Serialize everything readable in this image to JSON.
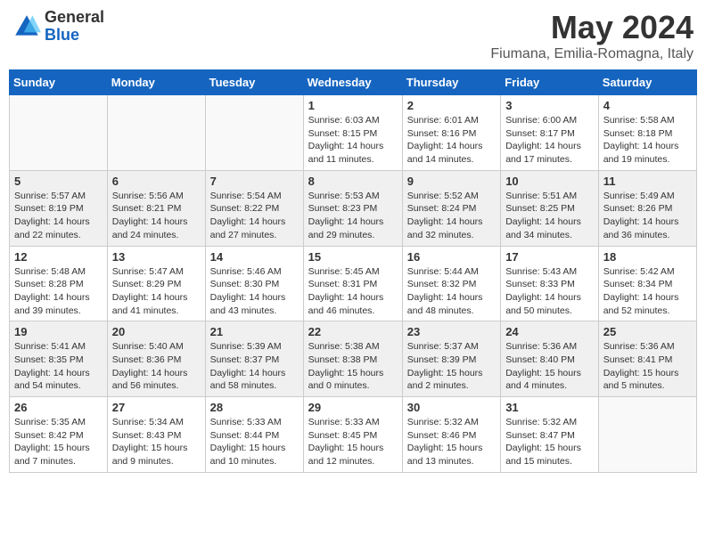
{
  "header": {
    "logo": {
      "general": "General",
      "blue": "Blue"
    },
    "month": "May 2024",
    "location": "Fiumana, Emilia-Romagna, Italy"
  },
  "weekdays": [
    "Sunday",
    "Monday",
    "Tuesday",
    "Wednesday",
    "Thursday",
    "Friday",
    "Saturday"
  ],
  "weeks": [
    [
      {
        "day": "",
        "info": ""
      },
      {
        "day": "",
        "info": ""
      },
      {
        "day": "",
        "info": ""
      },
      {
        "day": "1",
        "info": "Sunrise: 6:03 AM\nSunset: 8:15 PM\nDaylight: 14 hours\nand 11 minutes."
      },
      {
        "day": "2",
        "info": "Sunrise: 6:01 AM\nSunset: 8:16 PM\nDaylight: 14 hours\nand 14 minutes."
      },
      {
        "day": "3",
        "info": "Sunrise: 6:00 AM\nSunset: 8:17 PM\nDaylight: 14 hours\nand 17 minutes."
      },
      {
        "day": "4",
        "info": "Sunrise: 5:58 AM\nSunset: 8:18 PM\nDaylight: 14 hours\nand 19 minutes."
      }
    ],
    [
      {
        "day": "5",
        "info": "Sunrise: 5:57 AM\nSunset: 8:19 PM\nDaylight: 14 hours\nand 22 minutes."
      },
      {
        "day": "6",
        "info": "Sunrise: 5:56 AM\nSunset: 8:21 PM\nDaylight: 14 hours\nand 24 minutes."
      },
      {
        "day": "7",
        "info": "Sunrise: 5:54 AM\nSunset: 8:22 PM\nDaylight: 14 hours\nand 27 minutes."
      },
      {
        "day": "8",
        "info": "Sunrise: 5:53 AM\nSunset: 8:23 PM\nDaylight: 14 hours\nand 29 minutes."
      },
      {
        "day": "9",
        "info": "Sunrise: 5:52 AM\nSunset: 8:24 PM\nDaylight: 14 hours\nand 32 minutes."
      },
      {
        "day": "10",
        "info": "Sunrise: 5:51 AM\nSunset: 8:25 PM\nDaylight: 14 hours\nand 34 minutes."
      },
      {
        "day": "11",
        "info": "Sunrise: 5:49 AM\nSunset: 8:26 PM\nDaylight: 14 hours\nand 36 minutes."
      }
    ],
    [
      {
        "day": "12",
        "info": "Sunrise: 5:48 AM\nSunset: 8:28 PM\nDaylight: 14 hours\nand 39 minutes."
      },
      {
        "day": "13",
        "info": "Sunrise: 5:47 AM\nSunset: 8:29 PM\nDaylight: 14 hours\nand 41 minutes."
      },
      {
        "day": "14",
        "info": "Sunrise: 5:46 AM\nSunset: 8:30 PM\nDaylight: 14 hours\nand 43 minutes."
      },
      {
        "day": "15",
        "info": "Sunrise: 5:45 AM\nSunset: 8:31 PM\nDaylight: 14 hours\nand 46 minutes."
      },
      {
        "day": "16",
        "info": "Sunrise: 5:44 AM\nSunset: 8:32 PM\nDaylight: 14 hours\nand 48 minutes."
      },
      {
        "day": "17",
        "info": "Sunrise: 5:43 AM\nSunset: 8:33 PM\nDaylight: 14 hours\nand 50 minutes."
      },
      {
        "day": "18",
        "info": "Sunrise: 5:42 AM\nSunset: 8:34 PM\nDaylight: 14 hours\nand 52 minutes."
      }
    ],
    [
      {
        "day": "19",
        "info": "Sunrise: 5:41 AM\nSunset: 8:35 PM\nDaylight: 14 hours\nand 54 minutes."
      },
      {
        "day": "20",
        "info": "Sunrise: 5:40 AM\nSunset: 8:36 PM\nDaylight: 14 hours\nand 56 minutes."
      },
      {
        "day": "21",
        "info": "Sunrise: 5:39 AM\nSunset: 8:37 PM\nDaylight: 14 hours\nand 58 minutes."
      },
      {
        "day": "22",
        "info": "Sunrise: 5:38 AM\nSunset: 8:38 PM\nDaylight: 15 hours\nand 0 minutes."
      },
      {
        "day": "23",
        "info": "Sunrise: 5:37 AM\nSunset: 8:39 PM\nDaylight: 15 hours\nand 2 minutes."
      },
      {
        "day": "24",
        "info": "Sunrise: 5:36 AM\nSunset: 8:40 PM\nDaylight: 15 hours\nand 4 minutes."
      },
      {
        "day": "25",
        "info": "Sunrise: 5:36 AM\nSunset: 8:41 PM\nDaylight: 15 hours\nand 5 minutes."
      }
    ],
    [
      {
        "day": "26",
        "info": "Sunrise: 5:35 AM\nSunset: 8:42 PM\nDaylight: 15 hours\nand 7 minutes."
      },
      {
        "day": "27",
        "info": "Sunrise: 5:34 AM\nSunset: 8:43 PM\nDaylight: 15 hours\nand 9 minutes."
      },
      {
        "day": "28",
        "info": "Sunrise: 5:33 AM\nSunset: 8:44 PM\nDaylight: 15 hours\nand 10 minutes."
      },
      {
        "day": "29",
        "info": "Sunrise: 5:33 AM\nSunset: 8:45 PM\nDaylight: 15 hours\nand 12 minutes."
      },
      {
        "day": "30",
        "info": "Sunrise: 5:32 AM\nSunset: 8:46 PM\nDaylight: 15 hours\nand 13 minutes."
      },
      {
        "day": "31",
        "info": "Sunrise: 5:32 AM\nSunset: 8:47 PM\nDaylight: 15 hours\nand 15 minutes."
      },
      {
        "day": "",
        "info": ""
      }
    ]
  ]
}
